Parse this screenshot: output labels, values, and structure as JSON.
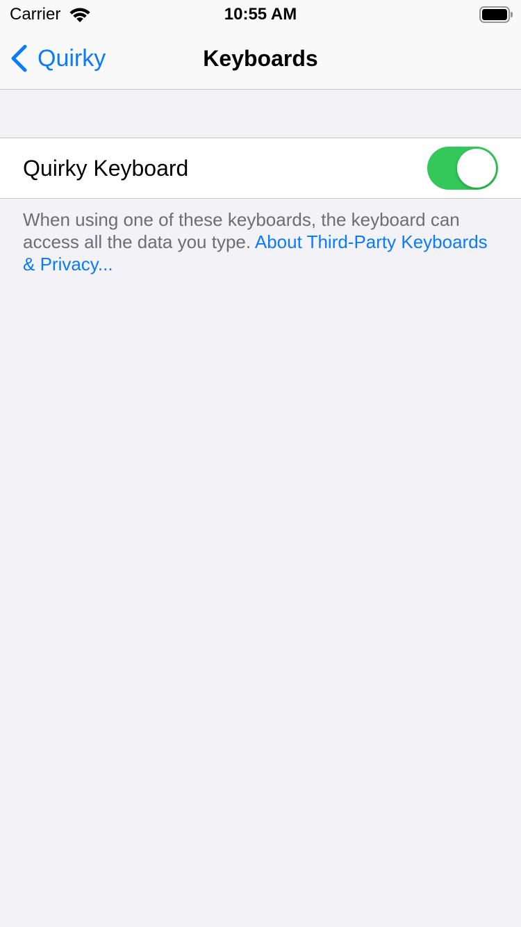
{
  "status_bar": {
    "carrier": "Carrier",
    "time": "10:55 AM",
    "wifi_icon": "wifi-icon",
    "battery_icon": "battery-full-icon"
  },
  "nav": {
    "back_label": "Quirky",
    "back_icon": "chevron-left-icon",
    "title": "Keyboards"
  },
  "cell": {
    "label": "Quirky Keyboard",
    "toggle_on": true
  },
  "footer": {
    "text": "When using one of these keyboards, the keyboard can access all the data you type. ",
    "link": "About Third-Party Keyboards & Privacy..."
  },
  "colors": {
    "accent": "#0a7aff",
    "toggle_on": "#34c759",
    "background": "#f2f2f7",
    "secondary_text": "#6d6d72"
  }
}
